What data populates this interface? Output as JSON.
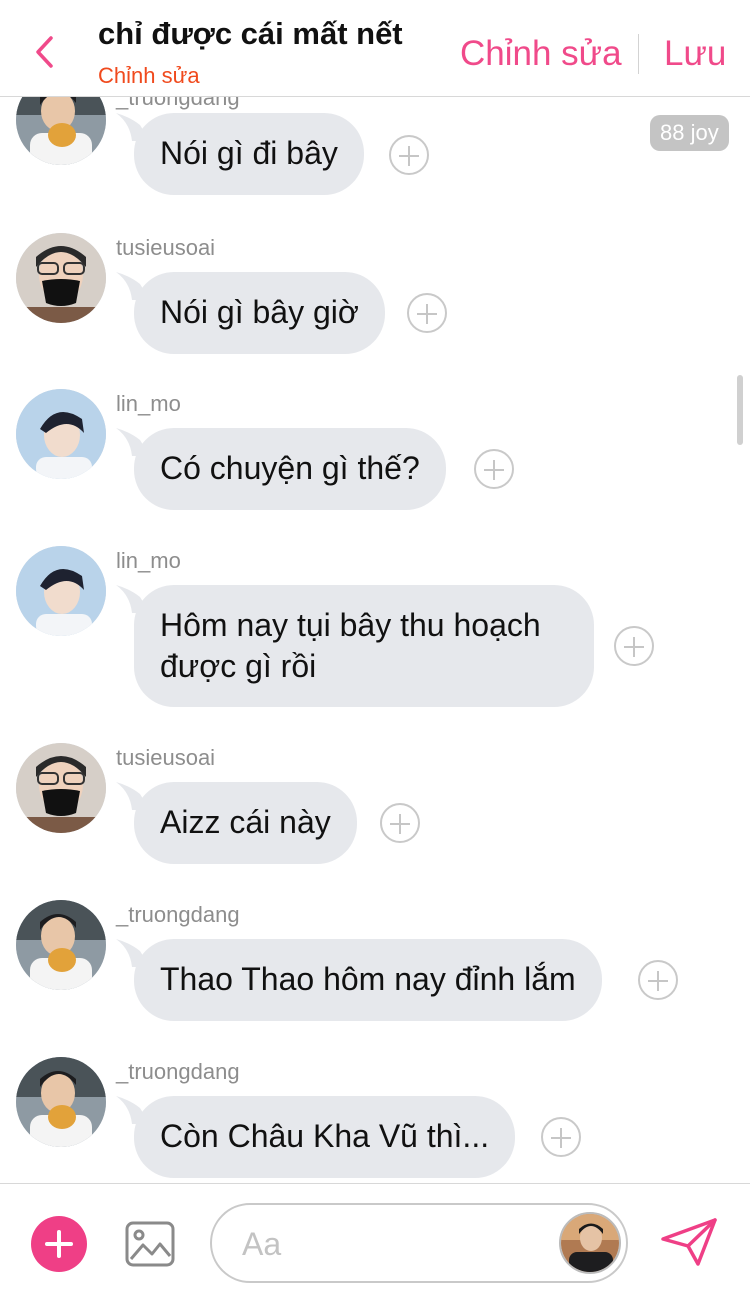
{
  "header": {
    "title": "chỉ được cái mất nết",
    "subtitle": "Chỉnh sửa",
    "edit_label": "Chỉnh sửa",
    "save_label": "Lưu",
    "accent_color": "#f04a8a",
    "subtitle_color": "#f04a1d"
  },
  "chat": {
    "joy_badge": "88 joy",
    "partial_top_username": "_truongdang",
    "messages": [
      {
        "username": "_truongdang",
        "avatar": "avatar-truongdang",
        "text": "Nói gì đi bây"
      },
      {
        "username": "tusieusoai",
        "avatar": "avatar-tusieusoai",
        "text": "Nói gì bây giờ"
      },
      {
        "username": "lin_mo",
        "avatar": "avatar-lin-mo",
        "text": "Có chuyện gì thế?"
      },
      {
        "username": "lin_mo",
        "avatar": "avatar-lin-mo",
        "text": "Hôm nay tụi bây thu hoạch được gì rồi"
      },
      {
        "username": "tusieusoai",
        "avatar": "avatar-tusieusoai",
        "text": "Aizz cái này"
      },
      {
        "username": "_truongdang",
        "avatar": "avatar-truongdang",
        "text": "Thao Thao hôm nay đỉnh lắm"
      },
      {
        "username": "_truongdang",
        "avatar": "avatar-truongdang",
        "text": "Còn Châu Kha Vũ thì..."
      }
    ]
  },
  "composer": {
    "placeholder": "Aa",
    "icons": [
      "plus-icon",
      "image-icon",
      "send-icon"
    ],
    "accent_color": "#ef3f86"
  }
}
